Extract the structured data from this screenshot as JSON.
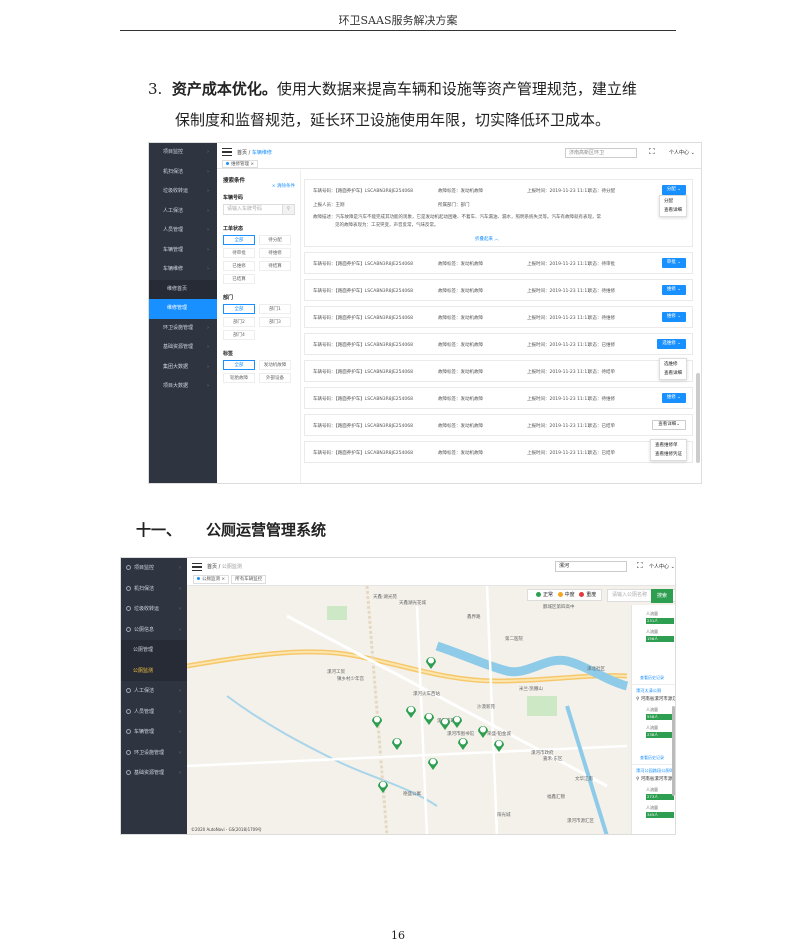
{
  "header": {
    "title": "环卫SAAS服务解决方案"
  },
  "para": {
    "num": "3.",
    "bold": "资产成本优化。",
    "line1_rest": "使用大数据来提高车辆和设施等资产管理规范，建立维",
    "line2": "保制度和监督规范，延长环卫设施使用年限，切实降低环卫成本。"
  },
  "section": {
    "num": "十一、",
    "title": "公厕运营管理系统"
  },
  "page_number": "16",
  "shot1": {
    "sidebar": [
      {
        "label": "项目监控",
        "kind": "item"
      },
      {
        "label": "机扫保洁",
        "kind": "item"
      },
      {
        "label": "垃圾收转运",
        "kind": "item"
      },
      {
        "label": "人工保洁",
        "kind": "item"
      },
      {
        "label": "人员管理",
        "kind": "item"
      },
      {
        "label": "车辆管理",
        "kind": "item"
      },
      {
        "label": "车辆维修",
        "kind": "item"
      },
      {
        "label": "维修首页",
        "kind": "sub"
      },
      {
        "label": "维修管理",
        "kind": "active"
      },
      {
        "label": "环卫设施管理",
        "kind": "item"
      },
      {
        "label": "基础资源管理",
        "kind": "item"
      },
      {
        "label": "集团大数据",
        "kind": "item"
      },
      {
        "label": "项目大数据",
        "kind": "item"
      }
    ],
    "breadcrumb_home": "首页",
    "breadcrumb_current": "车辆维修",
    "tag": "维修管理",
    "project_select": "济南高新区环卫",
    "user_center": "个人中心",
    "filter": {
      "title": "搜索条件",
      "clear": "× 清除条件",
      "plate_label": "车辆号码",
      "plate_placeholder": "请输入车牌号码",
      "status_label": "工单状态",
      "status_options": [
        "全部",
        "待分配",
        "待审批",
        "待维修",
        "已维修",
        "待结算",
        "已结算"
      ],
      "dept_label": "部门",
      "dept_options": [
        "全部",
        "部门1",
        "部门2",
        "部门3",
        "部门4"
      ],
      "tag_label": "标签",
      "tag_options": [
        "全部",
        "发动机故障",
        "轮胎故障",
        "外部设备"
      ]
    },
    "rows": [
      {
        "plate": "车辆号码：【路面养护车】LSCABN3R8JE254068",
        "fault": "故障标签：发动机故障",
        "time": "上报时间：2019-11-23 11:11",
        "status": "状态：待分配",
        "btn": "分配 ⌄",
        "ghost": false,
        "reporter": "上报人员：王刚",
        "dept": "所属部门：部门",
        "desc1": "故障描述：汽车故障是汽车不能完成其功能的现象，它是发动机起动困难、不着车、汽车漏油、漏水，照明系统失灵等。汽车有故障就有表现，常",
        "desc2": "见的故障表现为：工况突变，声音反常，气味反常。",
        "fold": "折叠起来 ︿"
      },
      {
        "plate": "车辆号码：【路面养护车】LSCABN3R8JE254068",
        "fault": "故障标签：发动机故障",
        "time": "上报时间：2019-11-23 11:11",
        "status": "状态：待审批",
        "btn": "审批 ⌄",
        "ghost": false
      },
      {
        "plate": "车辆号码：【路面养护车】LSCABN3R8JE254068",
        "fault": "故障标签：发动机故障",
        "time": "上报时间：2019-11-23 11:11",
        "status": "状态：待维修",
        "btn": "维修 ⌄",
        "ghost": false
      },
      {
        "plate": "车辆号码：【路面养护车】LSCABN3R8JE254068",
        "fault": "故障标签：发动机故障",
        "time": "上报时间：2019-11-23 11:11",
        "status": "状态：待维修",
        "btn": "维修 ⌄",
        "ghost": false
      },
      {
        "plate": "车辆号码：【路面养护车】LSCABN3R8JE254068",
        "fault": "故障标签：发动机故障",
        "time": "上报时间：2019-11-23 11:11",
        "status": "状态：已维修",
        "btn": "选维修 ⌄",
        "ghost": false
      },
      {
        "plate": "车辆号码：【路面养护车】LSCABN3R8JE254068",
        "fault": "故障标签：发动机故障",
        "time": "上报时间：2019-11-23 11:11",
        "status": "状态：待结单",
        "btn": "",
        "ghost": false
      },
      {
        "plate": "车辆号码：【路面养护车】LSCABN3R8JE254068",
        "fault": "故障标签：发动机故障",
        "time": "上报时间：2019-11-23 11:11",
        "status": "状态：待维修",
        "btn": "维修 ⌄",
        "ghost": false
      },
      {
        "plate": "车辆号码：【路面养护车】LSCABN3R8JE254068",
        "fault": "故障标签：发动机故障",
        "time": "上报时间：2019-11-23 11:11",
        "status": "状态：已结单",
        "btn": "查看详细⌄",
        "ghost": true
      },
      {
        "plate": "车辆号码：【路面养护车】LSCABN3R8JE254068",
        "fault": "故障标签：发动机故障",
        "time": "上报时间：2019-11-23 11:11",
        "status": "状态：已结单",
        "btn": "",
        "ghost": false
      }
    ],
    "dropdown1": [
      "分配",
      "查看详细"
    ],
    "dropdown2": [
      "选维修",
      "查看详细"
    ],
    "dropdown3": [
      "查看维修单",
      "查看维修凭证"
    ]
  },
  "shot2": {
    "sidebar": [
      {
        "label": "项目监控",
        "kind": "item"
      },
      {
        "label": "机扫保洁",
        "kind": "item"
      },
      {
        "label": "垃圾收转运",
        "kind": "item"
      },
      {
        "label": "公厕信息",
        "kind": "item"
      },
      {
        "label": "公厕管理",
        "kind": "sub"
      },
      {
        "label": "公厕监测",
        "kind": "active"
      },
      {
        "label": "人工保洁",
        "kind": "item"
      },
      {
        "label": "人员管理",
        "kind": "item"
      },
      {
        "label": "车辆管理",
        "kind": "item"
      },
      {
        "label": "环卫设施管理",
        "kind": "item"
      },
      {
        "label": "基础资源管理",
        "kind": "item"
      }
    ],
    "breadcrumb_home": "首页",
    "breadcrumb_current": "公厕监测",
    "tabs": [
      "公厕监测 ×",
      "所有车辆监控"
    ],
    "project_select": "漯河",
    "user_center": "个人中心",
    "legend": {
      "normal": "正常",
      "medium": "中度",
      "severe": "重度",
      "colors": {
        "normal": "#2e9e50",
        "medium": "#f5a623",
        "severe": "#e23b3b"
      }
    },
    "search_placeholder": "请输入公厕名称",
    "search_button": "搜索",
    "close": "⊗",
    "map_labels": [
      "天鑫·湖光苑",
      "天鑫湖光花城",
      "郾城区第四高中",
      "鑫界路",
      "第二医院",
      "漯河火车西站",
      "米兰·凯撒山",
      "泽北社区",
      "沙漠新苑",
      "漯河市图书馆",
      "荣盛·铂金城",
      "漯河市政府",
      "嘉禾·东区",
      "文华江南",
      "漯河工贸",
      "德盛公寓",
      "福鑫汇锦",
      "阳光城",
      "漯河市政府",
      "漯河市源汇区",
      "镇乡村少年宫"
    ],
    "copyright": "©2020 AutoNavi - GS(2018)1709号",
    "cards": [
      {
        "pname": "",
        "addr": "",
        "stats": [
          [
            "人流量",
            "231人"
          ],
          [
            "氨气",
            "0.03mg/m3"
          ],
          [
            "硫化氢",
            "0mg/m3"
          ],
          [
            "人流量",
            "156人"
          ],
          [
            "氨气",
            "0.37mg/m3"
          ],
          [
            "硫化氢",
            "0mg/m3"
          ]
        ],
        "hist": "查看历史记录"
      },
      {
        "pname": "漯河太清公厕",
        "addr": "河南省漯河市源汇区阴阳赵镇河西站",
        "stats": [
          [
            "人流量",
            "558人"
          ],
          [
            "氨气",
            "0.04mg/m3"
          ],
          [
            "硫化氢",
            "0mg/m3"
          ],
          [
            "人流量",
            "238人"
          ],
          [
            "氨气",
            "0.04mg/m3"
          ],
          [
            "硫化氢",
            "0mg/m3"
          ]
        ],
        "hist": "查看历史记录"
      },
      {
        "pname": "漯河公园路段公厕01",
        "addr": "河南省漯河市源汇区阴阳赵镇",
        "stats": [
          [
            "人流量",
            "273人"
          ],
          [
            "氨气",
            "0.12mg/m3"
          ],
          [
            "硫化氢",
            "0mg/m3"
          ],
          [
            "人流量",
            "345人"
          ],
          [
            "氨气",
            "0.16mg/m3"
          ],
          [
            "硫化氢",
            "0mg/m3"
          ]
        ],
        "hist": "查看历史记录"
      }
    ]
  }
}
